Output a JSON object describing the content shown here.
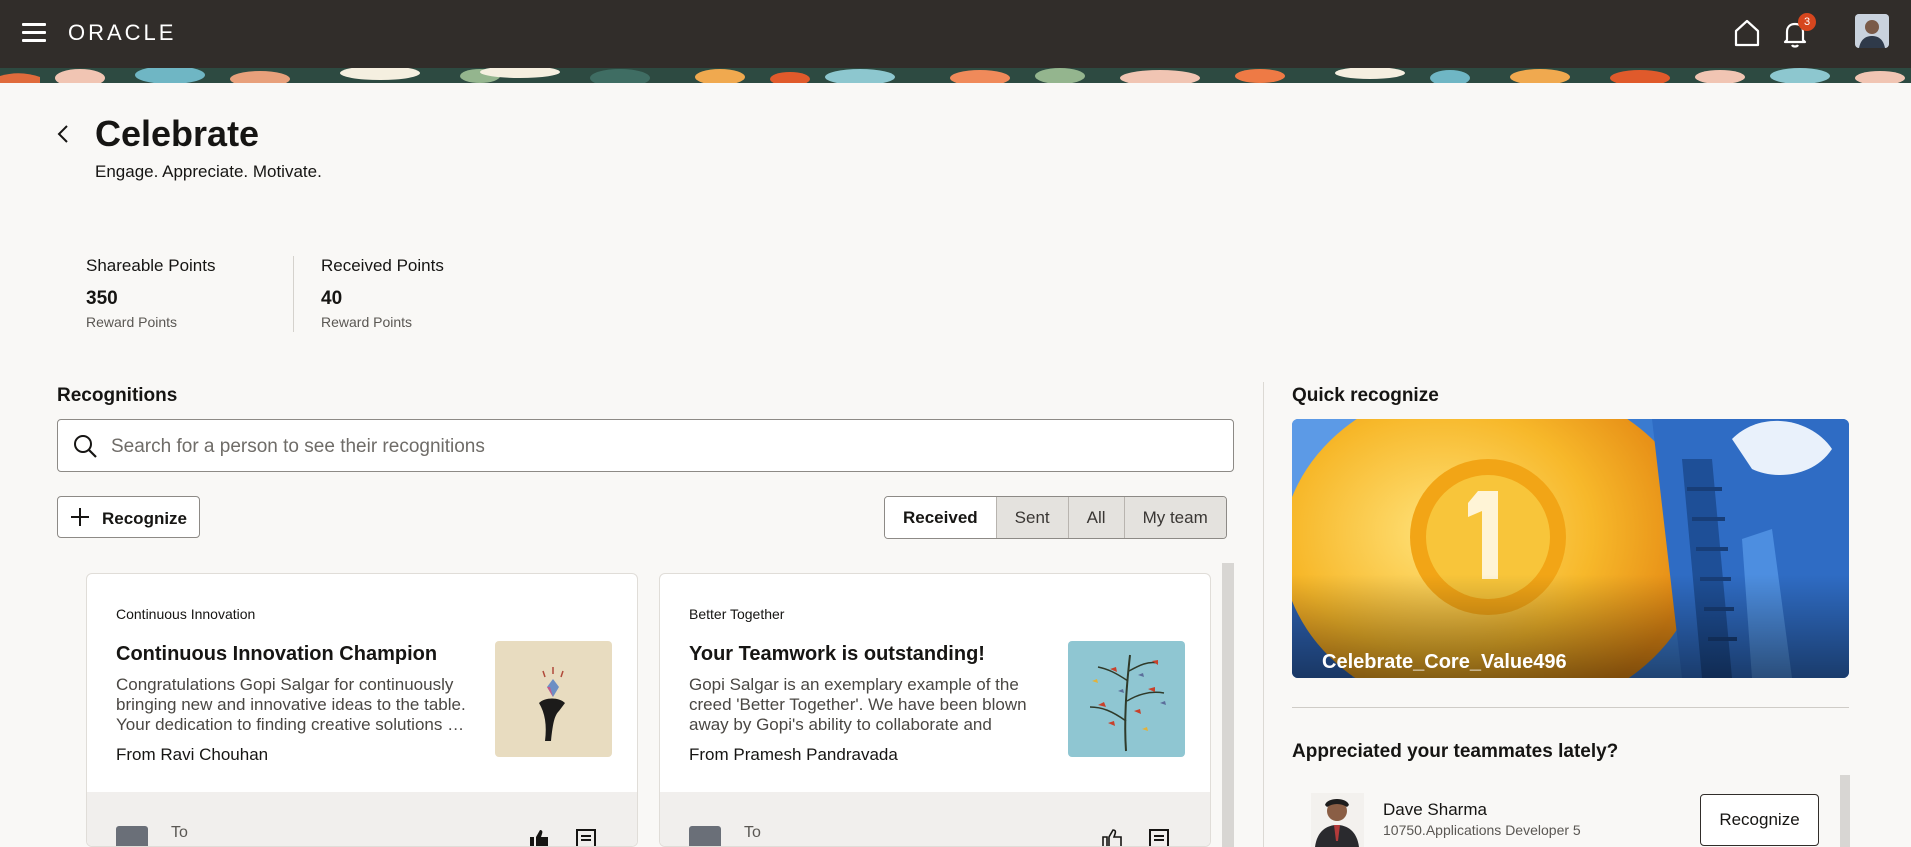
{
  "topbar": {
    "logo": "ORACLE",
    "notification_count": "3"
  },
  "header": {
    "title": "Celebrate",
    "subtitle": "Engage. Appreciate. Motivate."
  },
  "points": {
    "shareable": {
      "label": "Shareable Points",
      "value": "350",
      "unit": "Reward Points"
    },
    "received": {
      "label": "Received Points",
      "value": "40",
      "unit": "Reward Points"
    }
  },
  "recognitions": {
    "title": "Recognitions",
    "search_placeholder": "Search for a person to see their recognitions",
    "recognize_label": "Recognize",
    "filters": [
      "Received",
      "Sent",
      "All",
      "My team"
    ],
    "cards": [
      {
        "category": "Continuous Innovation",
        "title": "Continuous Innovation Champion",
        "body": "Congratulations Gopi Salgar for continuously bringing new and innovative ideas to the table. Your dedication to finding creative solutions …",
        "from": "From Ravi Chouhan",
        "to": "To"
      },
      {
        "category": "Better Together",
        "title": "Your Teamwork is outstanding!",
        "body": "Gopi Salgar is an exemplary example of the creed 'Better Together'. We have been blown away by Gopi's ability to collaborate and help…",
        "from": "From Pramesh Pandravada",
        "to": "To"
      }
    ]
  },
  "quick_recognize": {
    "title": "Quick recognize",
    "card_label": "Celebrate_Core_Value496",
    "teammates_title": "Appreciated your teammates lately?",
    "person": {
      "name": "Dave Sharma",
      "role": "10750.Applications Developer 5"
    },
    "recognize_label": "Recognize"
  }
}
